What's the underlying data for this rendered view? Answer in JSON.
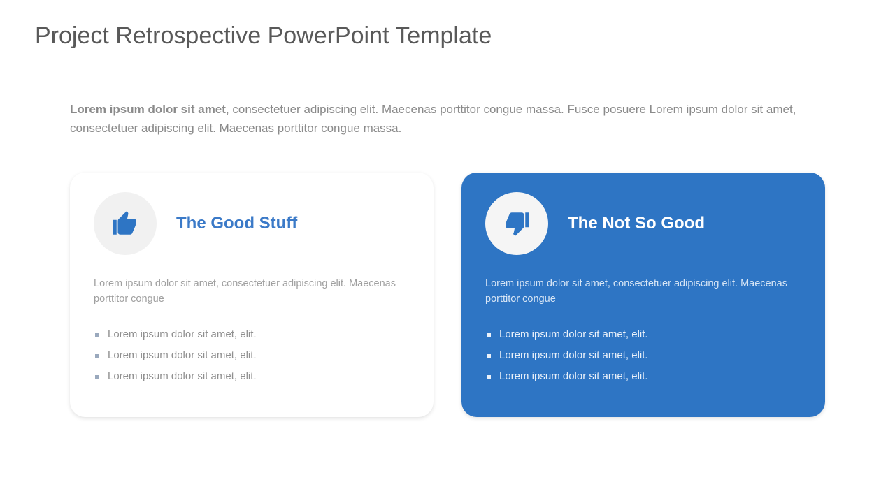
{
  "title": "Project Retrospective PowerPoint Template",
  "intro_bold": "Lorem ipsum dolor sit amet",
  "intro_rest": ", consectetuer adipiscing elit. Maecenas porttitor congue massa. Fusce posuere Lorem ipsum dolor sit amet, consectetuer adipiscing elit. Maecenas porttitor congue massa.",
  "good": {
    "title": "The Good Stuff",
    "desc": "Lorem ipsum dolor sit amet, consectetuer adipiscing elit. Maecenas porttitor congue",
    "bullets": [
      "Lorem ipsum dolor sit amet, elit.",
      "Lorem ipsum dolor sit amet, elit.",
      "Lorem ipsum dolor sit amet, elit."
    ]
  },
  "bad": {
    "title": "The Not So Good",
    "desc": "Lorem ipsum dolor sit amet, consectetuer adipiscing elit. Maecenas porttitor congue",
    "bullets": [
      "Lorem ipsum dolor sit amet, elit.",
      "Lorem ipsum dolor sit amet, elit.",
      "Lorem ipsum dolor sit amet, elit."
    ]
  },
  "colors": {
    "accent": "#2e75c4"
  }
}
